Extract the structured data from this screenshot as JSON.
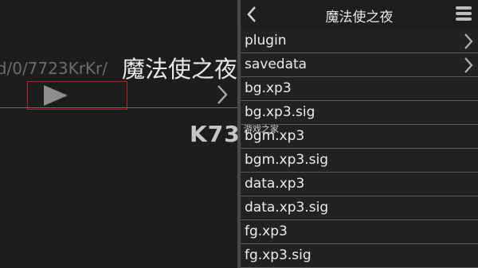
{
  "left_pane": {
    "path_text": "d/0/7723KrKr/",
    "game_title": "魔法使之夜",
    "play_icon": "play-icon",
    "chevron_icon": "chevron-right-icon"
  },
  "right_pane": {
    "header": {
      "back_icon": "chevron-left-icon",
      "title": "魔法使之夜",
      "menu_icon": "hamburger-menu-icon"
    },
    "files": [
      {
        "name": "plugin",
        "is_folder": true
      },
      {
        "name": "savedata",
        "is_folder": true
      },
      {
        "name": "bg.xp3",
        "is_folder": false
      },
      {
        "name": "bg.xp3.sig",
        "is_folder": false
      },
      {
        "name": "bgm.xp3",
        "is_folder": false
      },
      {
        "name": "bgm.xp3.sig",
        "is_folder": false
      },
      {
        "name": "data.xp3",
        "is_folder": false
      },
      {
        "name": "data.xp3.sig",
        "is_folder": false
      },
      {
        "name": "fg.xp3",
        "is_folder": false
      },
      {
        "name": "fg.xp3.sig",
        "is_folder": false
      }
    ]
  },
  "watermark": {
    "logo": "K73",
    "subtitle": "游戏之家"
  },
  "colors": {
    "play_highlight": "#c01d1d",
    "background": "#1d1d1d",
    "text": "#ececec"
  }
}
